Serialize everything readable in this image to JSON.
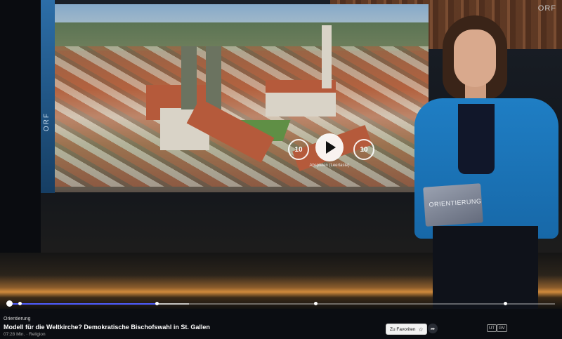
{
  "player": {
    "studio_logo": "ORF",
    "corner_logo": "ORF",
    "play_hint": "Abspielen (Leertaste)",
    "skip_back_label": "10",
    "skip_forward_label": "10",
    "folder_text": "ORIENTIERUNG",
    "progress": {
      "played_fraction": 0.27,
      "buffered_fraction": 0.33
    }
  },
  "video": {
    "category": "Orientierung",
    "title": "Modell für die Weltkirche? Demokratische Bischofswahl in St. Gallen",
    "meta": "07:28 Min. · Religion"
  },
  "actions": {
    "favorite_label": "Zu Favoriten",
    "favorite_icon": "star-icon",
    "share_icon": "share-icon"
  },
  "badges": [
    "UT",
    "GV"
  ],
  "colors": {
    "progress_played": "#4f5dff",
    "jacket": "#1f7ec4"
  }
}
